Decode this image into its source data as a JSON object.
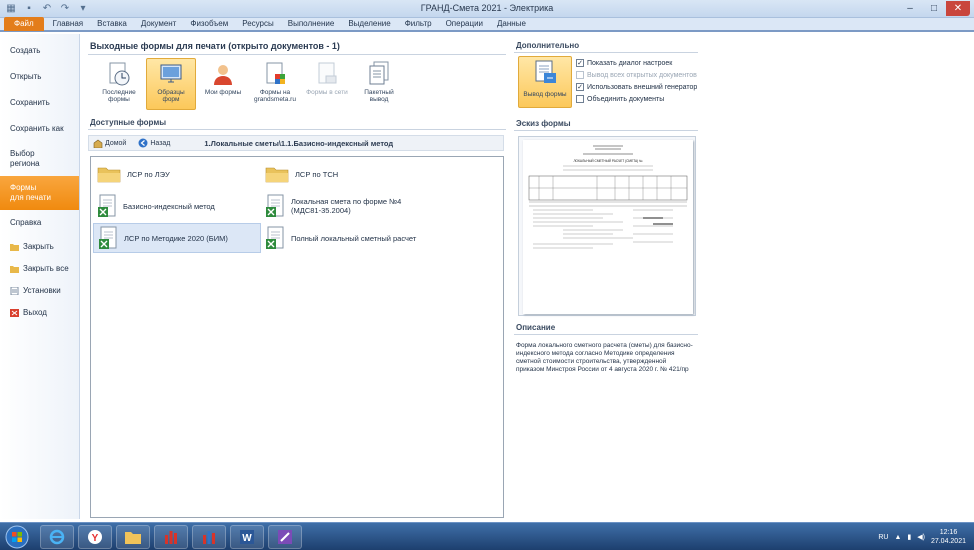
{
  "window": {
    "title": "ГРАНД-Смета 2021 - Электрика"
  },
  "tabs": [
    "Файл",
    "Главная",
    "Вставка",
    "Документ",
    "Физобъем",
    "Ресурсы",
    "Выполнение",
    "Выделение",
    "Фильтр",
    "Операции",
    "Данные"
  ],
  "leftmenu": {
    "create": "Создать",
    "open": "Открыть",
    "save": "Сохранить",
    "saveas": "Сохранить как",
    "region1": "Выбор",
    "region2": "региона",
    "forms1": "Формы",
    "forms2": "для печати",
    "help": "Справка",
    "close": "Закрыть",
    "closeall": "Закрыть все",
    "settings": "Установки",
    "exit": "Выход"
  },
  "center": {
    "heading": "Выходные формы для печати (открыто документов - 1)",
    "buttons": [
      {
        "l1": "Последние",
        "l2": "формы"
      },
      {
        "l1": "Образцы",
        "l2": "форм"
      },
      {
        "l1": "Мои формы",
        "l2": ""
      },
      {
        "l1": "Формы на",
        "l2": "grandsmeta.ru"
      },
      {
        "l1": "Формы в сети",
        "l2": ""
      },
      {
        "l1": "Пакетный",
        "l2": "вывод"
      }
    ],
    "available": "Доступные формы",
    "home": "Домой",
    "back": "Назад",
    "path": "1.Локальные сметы\\1.1.Базисно-индексный метод",
    "files": {
      "f1": "ЛСР по ЛЭУ",
      "f2": "ЛСР по ТСН",
      "f3": "Базисно-индексный метод",
      "f4a": "Локальная смета по форме №4",
      "f4b": "(МДС81-35.2004)",
      "f5": "ЛСР по Методике 2020 (БИМ)",
      "f6": "Полный локальный сметный расчет"
    }
  },
  "right": {
    "extra": "Дополнительно",
    "output": "Вывод формы",
    "c1": "Показать диалог настроек",
    "c2": "Вывод всех открытых документов",
    "c3": "Использовать внешний генератор",
    "c4": "Объединить документы",
    "sketch": "Эскиз формы",
    "description": "Описание",
    "desc_text": "Форма локального сметного расчета (сметы) для базисно-индексного метода согласно Методике определения сметной стоимости строительства, утвержденной приказом Минстроя России от 4 августа 2020 г. № 421/пр",
    "preview_title": "ЛОКАЛЬНЫЙ СМЕТНЫЙ РАСЧЕТ (СМЕТА) №"
  },
  "taskbar": {
    "lang": "RU",
    "time": "12:16",
    "date": "27.04.2021"
  },
  "colors": {
    "accent": "#f08a0f",
    "ribbon": "#dbe7f6",
    "taskbar": "#1d3f6e"
  }
}
